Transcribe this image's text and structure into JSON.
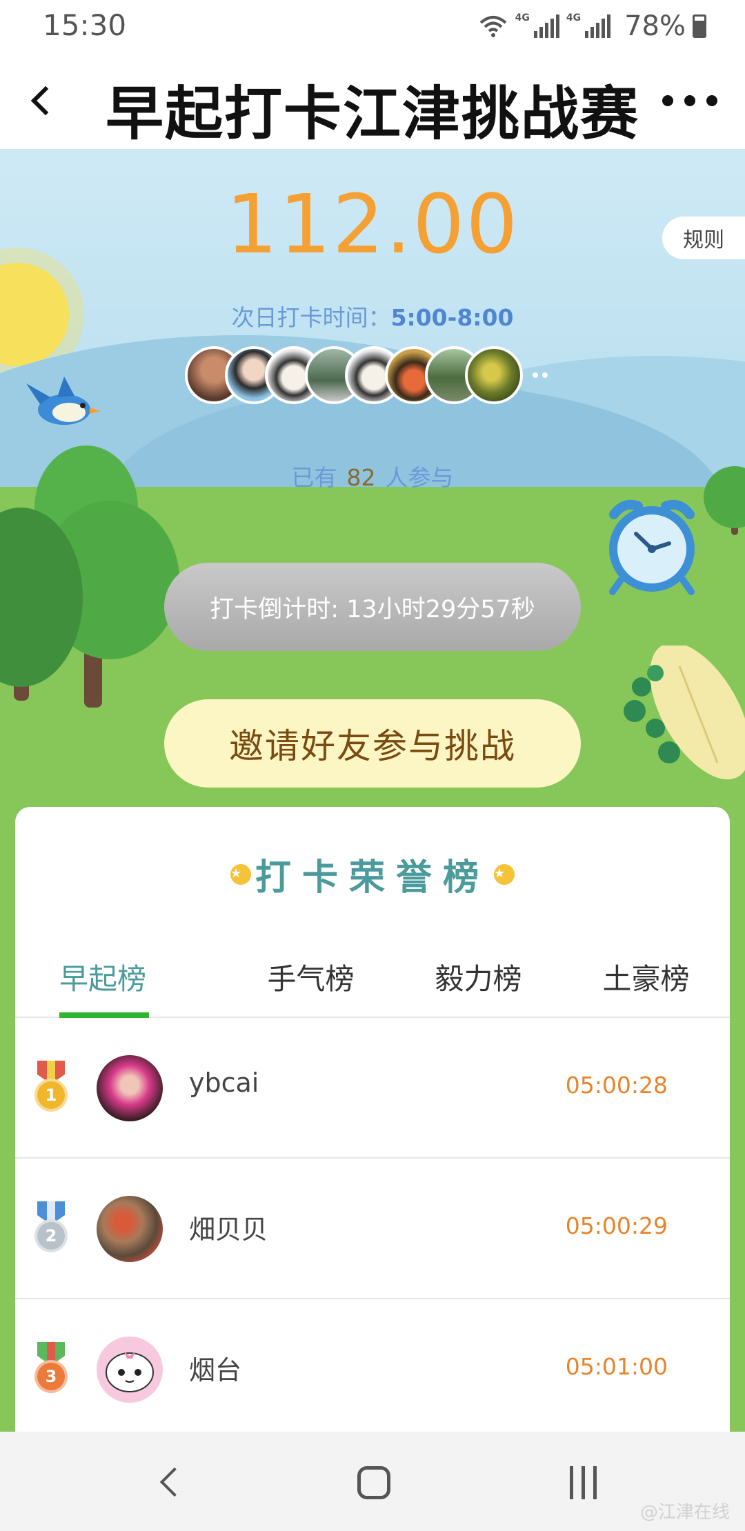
{
  "status_bar": {
    "time": "15:30",
    "network_1": "4G",
    "network_2": "4G",
    "battery": "78%",
    "icons": [
      "wifi-icon",
      "signal-icon",
      "battery-icon"
    ]
  },
  "header": {
    "title": "早起打卡江津挑战赛",
    "back_icon": "back-arrow-icon",
    "more_icon": "more-dots-icon"
  },
  "hero": {
    "amount": "112.00",
    "rules_label": "规则",
    "next_time_label": "次日打卡时间：",
    "next_time_value": "5:00-8:00",
    "participants_prefix": "已有",
    "participants_count": "82",
    "participants_suffix": "人参与",
    "countdown_text": "打卡倒计时: 13小时29分57秒",
    "invite_label": "邀请好友参与挑战"
  },
  "leaderboard": {
    "title": "打卡荣誉榜",
    "tabs": [
      {
        "label": "早起榜",
        "active": true
      },
      {
        "label": "手气榜",
        "active": false
      },
      {
        "label": "毅力榜",
        "active": false
      },
      {
        "label": "土豪榜",
        "active": false
      }
    ],
    "rows": [
      {
        "rank": "1",
        "name": "ybcai",
        "time": "05:00:28",
        "medal": "gold"
      },
      {
        "rank": "2",
        "name": "畑贝贝",
        "time": "05:00:29",
        "medal": "silver"
      },
      {
        "rank": "3",
        "name": "烟台",
        "time": "05:01:00",
        "medal": "bronze"
      }
    ]
  },
  "nav": {
    "watermark": "@江津在线"
  },
  "colors": {
    "amount": "#f5a033",
    "accent_teal": "#4b9b9c",
    "tab_underline": "#2fb52f",
    "time_orange": "#e8842a",
    "grass": "#87c75a",
    "sky": "#cfe9f6"
  }
}
